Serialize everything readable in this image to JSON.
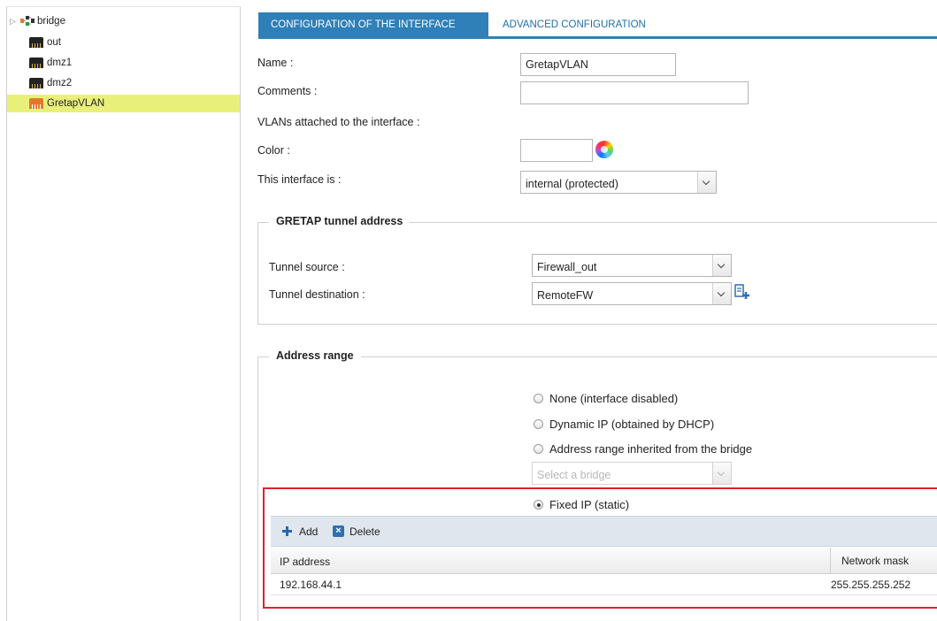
{
  "tree": {
    "items": [
      {
        "label": "bridge",
        "icon": "bridge-icon"
      },
      {
        "label": "out",
        "icon": "ethernet-port-icon"
      },
      {
        "label": "dmz1",
        "icon": "ethernet-port-icon"
      },
      {
        "label": "dmz2",
        "icon": "ethernet-port-icon"
      },
      {
        "label": "GretapVLAN",
        "icon": "gretap-interface-icon",
        "selected": true
      }
    ]
  },
  "tabs": [
    {
      "label": "CONFIGURATION OF THE INTERFACE",
      "active": true
    },
    {
      "label": "ADVANCED CONFIGURATION",
      "active": false
    }
  ],
  "form": {
    "name_label": "Name :",
    "name_value": "GretapVLAN",
    "comments_label": "Comments :",
    "comments_value": "",
    "vlans_label": "VLANs attached to the interface :",
    "color_label": "Color :",
    "interface_is_label": "This interface is :",
    "interface_is_value": "internal (protected)"
  },
  "gretap": {
    "legend": "GRETAP tunnel address",
    "source_label": "Tunnel source :",
    "source_value": "Firewall_out",
    "destination_label": "Tunnel destination :",
    "destination_value": "RemoteFW"
  },
  "address_range": {
    "legend": "Address range",
    "options": [
      {
        "label": "None (interface disabled)",
        "checked": false
      },
      {
        "label": "Dynamic IP (obtained by DHCP)",
        "checked": false
      },
      {
        "label": "Address range inherited from the bridge",
        "checked": false
      },
      {
        "label": "Fixed IP (static)",
        "checked": true
      }
    ],
    "bridge_select_placeholder": "Select a bridge",
    "toolbar": {
      "add_label": "Add",
      "delete_label": "Delete"
    },
    "table": {
      "columns": [
        "IP address",
        "Network mask"
      ],
      "rows": [
        {
          "ip": "192.168.44.1",
          "mask": "255.255.255.252"
        }
      ]
    }
  },
  "colors": {
    "accent": "#2f7fb8",
    "selection": "#e9f07a",
    "highlight_box": "#e0212b"
  }
}
